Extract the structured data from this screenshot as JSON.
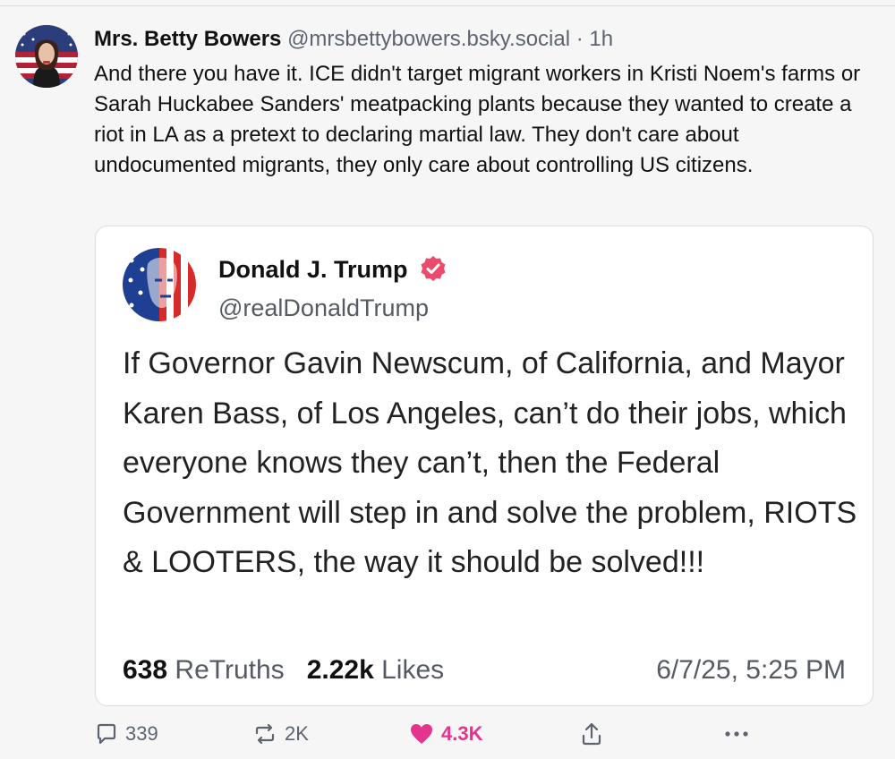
{
  "post": {
    "author_name": "Mrs. Betty Bowers",
    "author_handle": "@mrsbettybowers.bsky.social",
    "separator": "·",
    "time": "1h",
    "text": "And there you have it. ICE didn't target migrant workers in Kristi Noem's farms or Sarah Huckabee Sanders' meatpacking plants because they wanted to create a riot in LA as a pretext to declaring martial law. They don't care about undocumented migrants, they only care about controlling US citizens."
  },
  "quote": {
    "author_name": "Donald J. Trump",
    "author_handle": "@realDonaldTrump",
    "verified_icon": "verified-badge-icon",
    "text": "If Governor Gavin Newscum, of California, and Mayor Karen Bass, of Los Angeles, can’t do their jobs, which everyone knows they can’t, then the Federal Government will step in and solve the problem, RIOTS & LOOTERS, the way it should be solved!!!",
    "retruths_count": "638",
    "retruths_label": "ReTruths",
    "likes_count": "2.22k",
    "likes_label": "Likes",
    "date": "6/7/25, 5:25 PM"
  },
  "actions": {
    "reply_count": "339",
    "repost_count": "2K",
    "like_count": "4.3K",
    "icons": [
      "reply-icon",
      "repost-icon",
      "heart-icon",
      "share-icon",
      "more-icon"
    ]
  },
  "colors": {
    "accent_like": "#e4348e",
    "verified": "#ec4b6e",
    "muted_text": "#5d6470"
  }
}
